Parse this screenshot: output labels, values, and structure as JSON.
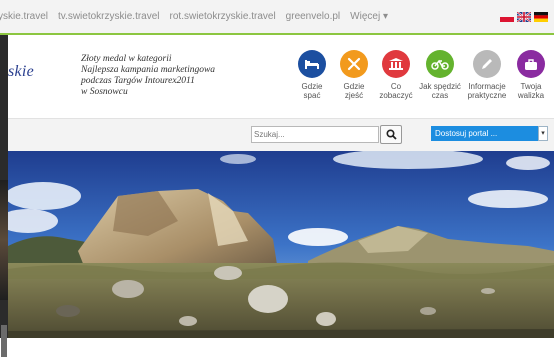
{
  "topbar": {
    "links": [
      "yskie.travel",
      "tv.swietokrzyskie.travel",
      "rot.swietokrzyskie.travel",
      "greenvelo.pl",
      "Więcej ▾"
    ],
    "flags": [
      "pl",
      "gb",
      "de"
    ]
  },
  "header": {
    "logo_text": "skie",
    "award_lines": [
      "Złoty medal w kategorii",
      "Najlepsza kampania marketingowa",
      "podczas Targów Intourex2011",
      "w Sosnowcu"
    ]
  },
  "nav_icons": [
    {
      "line1": "Gdzie",
      "line2": "spać",
      "color": "#1c4fa0",
      "icon": "bed-icon"
    },
    {
      "line1": "Gdzie",
      "line2": "zjeść",
      "color": "#f29a1d",
      "icon": "cutlery-icon"
    },
    {
      "line1": "Co",
      "line2": "zobaczyć",
      "color": "#e0393e",
      "icon": "monument-icon"
    },
    {
      "line1": "Jak spędzić",
      "line2": "czas",
      "color": "#64b32e",
      "icon": "bike-icon"
    },
    {
      "line1": "Informacje",
      "line2": "praktyczne",
      "color": "#b9b9b9",
      "icon": "pencil-icon"
    },
    {
      "line1": "Twoja",
      "line2": "walizka",
      "color": "#8a2ba0",
      "icon": "suitcase-icon"
    }
  ],
  "search": {
    "placeholder": "Szukaj..."
  },
  "portal_select": {
    "value": "Dostosuj portal ..."
  },
  "colors": {
    "accent_green": "#8cc640",
    "portal_blue": "#1c8de0",
    "logo_blue": "#2a3f8f"
  }
}
